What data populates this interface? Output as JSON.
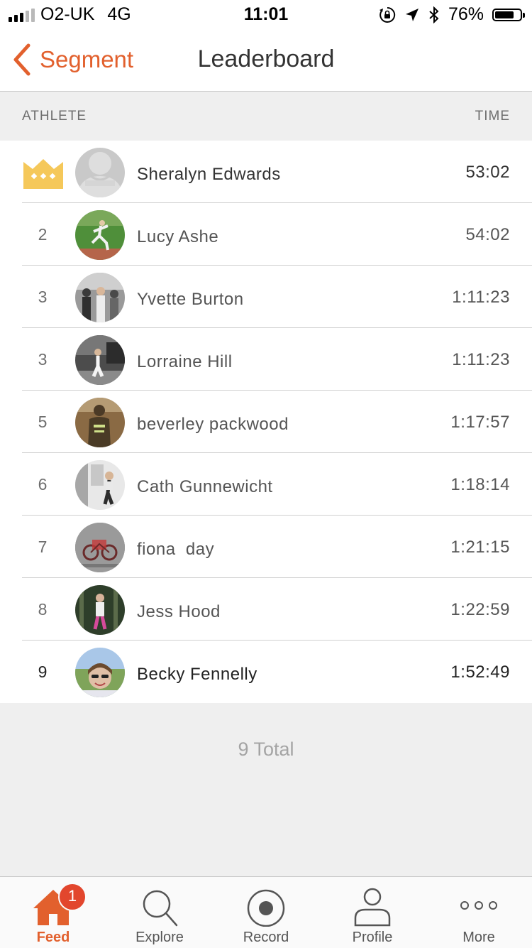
{
  "status_bar": {
    "carrier": "O2-UK",
    "network": "4G",
    "time": "11:01",
    "battery": "76%",
    "battery_level": 0.76
  },
  "nav": {
    "back_label": "Segment",
    "title": "Leaderboard"
  },
  "columns": {
    "athlete": "ATHLETE",
    "time": "TIME"
  },
  "leaderboard": [
    {
      "rank": "",
      "name": "Sheralyn Edwards",
      "time": "53:02"
    },
    {
      "rank": "2",
      "name": "Lucy Ashe",
      "time": "54:02"
    },
    {
      "rank": "3",
      "name": "Yvette Burton",
      "time": "1:11:23"
    },
    {
      "rank": "3",
      "name": "Lorraine Hill",
      "time": "1:11:23"
    },
    {
      "rank": "5",
      "name": "beverley packwood",
      "time": "1:17:57"
    },
    {
      "rank": "6",
      "name": "Cath Gunnewicht",
      "time": "1:18:14"
    },
    {
      "rank": "7",
      "name": "fiona  day",
      "time": "1:21:15"
    },
    {
      "rank": "8",
      "name": "Jess Hood",
      "time": "1:22:59"
    },
    {
      "rank": "9",
      "name": "Becky Fennelly",
      "time": "1:52:49"
    }
  ],
  "total": "9 Total",
  "tabs": [
    {
      "label": "Feed",
      "badge": "1"
    },
    {
      "label": "Explore"
    },
    {
      "label": "Record"
    },
    {
      "label": "Profile"
    },
    {
      "label": "More"
    }
  ],
  "colors": {
    "accent": "#e2602d",
    "crown": "#f5c85a",
    "badge": "#e2462d"
  }
}
